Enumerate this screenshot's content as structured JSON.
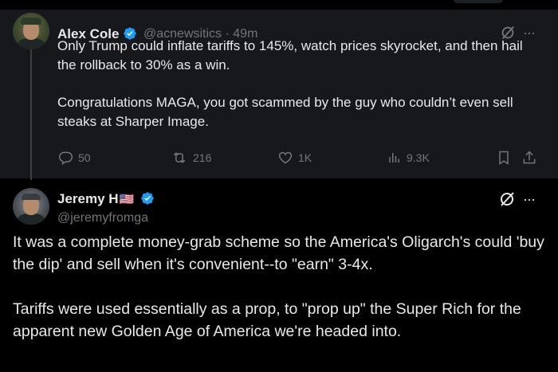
{
  "tweet1": {
    "author_name": "Alex Cole",
    "handle": "@acnewsitics",
    "separator": "·",
    "time": "49m",
    "text_lines": [
      "Only Trump could inflate tariffs to 145%, watch prices skyrocket, and then hail the rollback to 30% as a win.",
      "Congratulations MAGA, you got scammed by the guy who couldn’t even sell steaks at Sharper Image."
    ],
    "actions": {
      "replies": "50",
      "reposts": "216",
      "likes": "1K",
      "views": "9.3K"
    },
    "more_label": "···"
  },
  "tweet2": {
    "author_name": "Jeremy H",
    "flag": "🇺🇸",
    "handle": "@jeremyfromga",
    "text_lines": [
      "It was a complete money-grab scheme so the America's Oligarch's could 'buy the dip' and sell when it's convenient--to \"earn\" 3-4x.",
      "Tariffs were used essentially as a prop, to \"prop up\" the Super Rich for the apparent new Golden Age of America we're headed into."
    ],
    "more_label": "···"
  },
  "colors": {
    "background": "#000000",
    "highlight_background": "#16181c",
    "text": "#e7e9ea",
    "secondary_text": "#71767b",
    "verified_blue": "#1d9bf0"
  }
}
